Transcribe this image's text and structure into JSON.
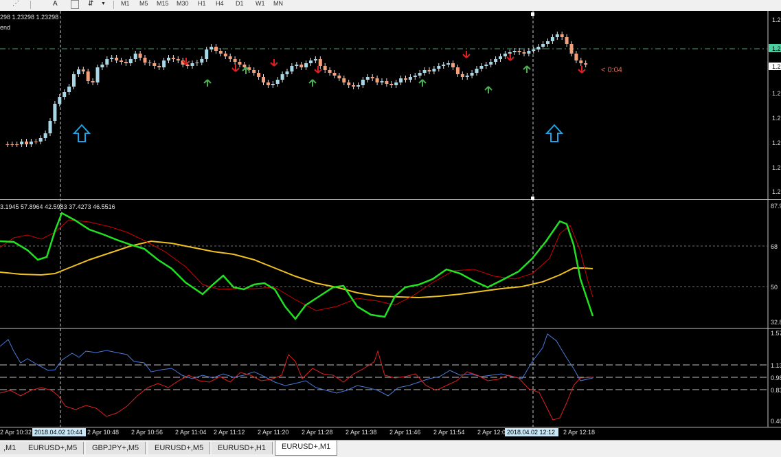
{
  "toolbar": {
    "icons": [
      {
        "name": "line-studies-icon",
        "glyph": "⋰"
      },
      {
        "name": "text-label-icon",
        "glyph": "A"
      },
      {
        "name": "arrows-icon",
        "glyph": "⇵"
      }
    ],
    "timeframes": [
      "M1",
      "M5",
      "M15",
      "M30",
      "H1",
      "H4",
      "D1",
      "W1",
      "MN"
    ]
  },
  "main_chart": {
    "info_line": "298 1.23298 1.23298",
    "indicator_label": "end",
    "countdown": "< 0:04",
    "price_axis": [
      "1.2",
      "1.2",
      "1.2",
      "1.2",
      "1.2",
      "1.2",
      "1.2",
      "1.2"
    ],
    "colors": {
      "bull": "#a8d8e8",
      "bear": "#f4a07a",
      "up_arrow": "#4caf50",
      "down_arrow": "#e02020",
      "big_arrow": "#1fa3e8"
    }
  },
  "osc1": {
    "values_line": "3.1945 57.8964 42.5983 37.4273 46.5516",
    "axis": [
      "87.9",
      "68",
      "50",
      "32.8"
    ],
    "colors": {
      "fast": "#22e022",
      "slow": "#d00000",
      "signal": "#f0c020"
    }
  },
  "osc2": {
    "axis": [
      "1.57",
      "1.13",
      "0.98",
      "0.83",
      "0.40"
    ],
    "colors": {
      "blue": "#4a7ad8",
      "red": "#e02020"
    }
  },
  "time_axis": {
    "labels": [
      "2 Apr 10:32",
      "2018.04.02 10:44",
      "2 Apr 10:48",
      "2 Apr 10:56",
      "2 Apr 11:04",
      "2 Apr 11:12",
      "2 Apr 11:20",
      "2 Apr 11:28",
      "2 Apr 11:38",
      "2 Apr 11:46",
      "2 Apr 11:54",
      "2 Apr 12:0",
      "2018.04.02 12:12",
      "2 Apr 12:18"
    ]
  },
  "tabs": [
    {
      "label": ",M1",
      "active": false
    },
    {
      "label": "EURUSD+,M5",
      "active": false
    },
    {
      "label": "GBPJPY+,M5",
      "active": false
    },
    {
      "label": "EURUSD+,M5",
      "active": false
    },
    {
      "label": "EURUSD+,H1",
      "active": false
    },
    {
      "label": "EURUSD+,M1",
      "active": true
    }
  ]
}
